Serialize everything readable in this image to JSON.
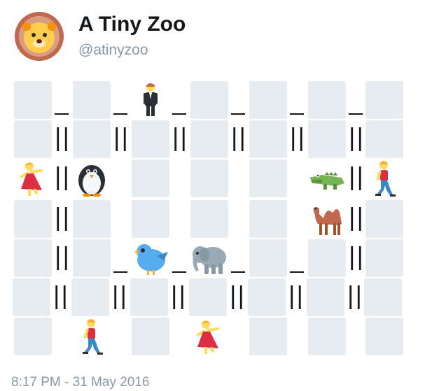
{
  "tweet": {
    "display_name": "A Tiny Zoo",
    "handle": "@atinyzoo",
    "timestamp": "8:17 PM - 31 May 2016",
    "avatar_icon": "lion-face-icon"
  },
  "zoo_grid": {
    "rows": 7,
    "cols": 7,
    "wall_glyph": "||",
    "floor_glyph": "_",
    "tile_color": "#e1e8ed",
    "animals": [
      {
        "name": "person-in-suit-icon",
        "row": 0,
        "col": 2
      },
      {
        "name": "dancer-icon",
        "row": 2,
        "col": 0
      },
      {
        "name": "penguin-icon",
        "row": 2,
        "col": 1
      },
      {
        "name": "crocodile-icon",
        "row": 2,
        "col": 5
      },
      {
        "name": "walking-person-icon",
        "row": 2,
        "col": 6
      },
      {
        "name": "camel-icon",
        "row": 3,
        "col": 5
      },
      {
        "name": "bird-icon",
        "row": 4,
        "col": 2
      },
      {
        "name": "elephant-icon",
        "row": 4,
        "col": 3
      },
      {
        "name": "walking-person-icon",
        "row": 6,
        "col": 1
      },
      {
        "name": "dancer-icon",
        "row": 6,
        "col": 3
      }
    ]
  }
}
